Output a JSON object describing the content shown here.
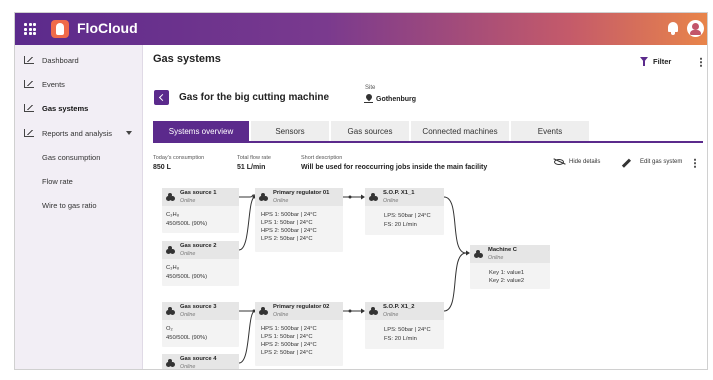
{
  "app": {
    "title": "FloCloud"
  },
  "sidebar": {
    "items": [
      {
        "label": "Dashboard"
      },
      {
        "label": "Events"
      },
      {
        "label": "Gas systems"
      },
      {
        "label": "Reports and analysis"
      },
      {
        "label": "Gas consumption"
      },
      {
        "label": "Flow rate"
      },
      {
        "label": "Wire to gas ratio"
      }
    ]
  },
  "page": {
    "title": "Gas systems",
    "filter_label": "Filter",
    "system_name": "Gas for the big cutting machine",
    "site_label": "Site",
    "site_value": "Gothenburg"
  },
  "tabs": [
    {
      "label": "Systems overview"
    },
    {
      "label": "Sensors"
    },
    {
      "label": "Gas sources"
    },
    {
      "label": "Connected machines"
    },
    {
      "label": "Events"
    }
  ],
  "info": {
    "consumption_label": "Today's consumption",
    "consumption_value": "850 L",
    "flow_label": "Total flow rate",
    "flow_value": "51 L/min",
    "desc_label": "Short description",
    "desc_value": "Will be used for reoccurring jobs inside the main facility",
    "hide_details": "Hide details",
    "edit_system": "Edit gas system"
  },
  "nodes": {
    "gs1": {
      "name": "Gas source 1",
      "status": "Online",
      "gas": "C₃H₈",
      "level": "450/500L (90%)"
    },
    "gs2": {
      "name": "Gas source 2",
      "status": "Online",
      "gas": "C₃H₈",
      "level": "450/500L (90%)"
    },
    "gs3": {
      "name": "Gas source 3",
      "status": "Online",
      "gas": "O₂",
      "level": "450/500L (90%)"
    },
    "gs4": {
      "name": "Gas source 4",
      "status": "Online"
    },
    "pr1": {
      "name": "Primary regulator 01",
      "status": "Online",
      "lines": [
        "HPS 1: 500bar | 24°C",
        "LPS 1: 50bar | 24°C",
        "HPS 2: 500bar | 24°C",
        "LPS 2: 50bar | 24°C"
      ]
    },
    "pr2": {
      "name": "Primary regulator 02",
      "status": "Online",
      "lines": [
        "HPS 1: 500bar | 24°C",
        "LPS 1: 50bar | 24°C",
        "HPS 2: 500bar | 24°C",
        "LPS 2: 50bar | 24°C"
      ]
    },
    "sop1": {
      "name": "S.O.P. X1_1",
      "status": "Online",
      "lines": [
        "LPS: 50bar | 24°C",
        "FS: 20 L/min"
      ]
    },
    "sop2": {
      "name": "S.O.P. X1_2",
      "status": "Online",
      "lines": [
        "LPS: 50bar | 24°C",
        "FS: 20 L/min"
      ]
    },
    "machine": {
      "name": "Machine C",
      "status": "Online",
      "lines": [
        "Key 1: value1",
        "Key 2: value2"
      ]
    }
  },
  "colors": {
    "accent": "#5b2a8c",
    "header_start": "#5b2a8c",
    "header_end": "#e8844a"
  }
}
